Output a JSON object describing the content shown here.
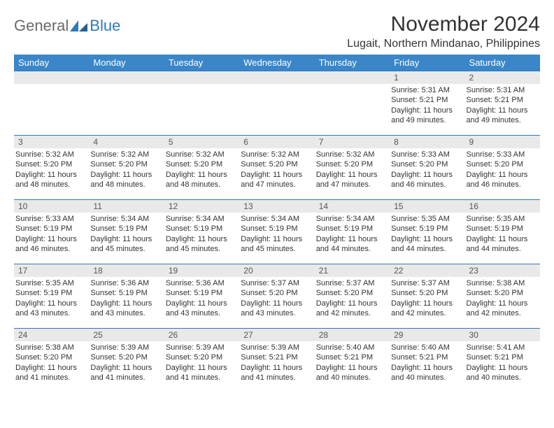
{
  "brand": {
    "general": "General",
    "blue": "Blue"
  },
  "title": "November 2024",
  "location": "Lugait, Northern Mindanao, Philippines",
  "weekdays": [
    "Sunday",
    "Monday",
    "Tuesday",
    "Wednesday",
    "Thursday",
    "Friday",
    "Saturday"
  ],
  "weeks": [
    [
      null,
      null,
      null,
      null,
      null,
      {
        "n": "1",
        "sr": "Sunrise: 5:31 AM",
        "ss": "Sunset: 5:21 PM",
        "dl": "Daylight: 11 hours and 49 minutes."
      },
      {
        "n": "2",
        "sr": "Sunrise: 5:31 AM",
        "ss": "Sunset: 5:21 PM",
        "dl": "Daylight: 11 hours and 49 minutes."
      }
    ],
    [
      {
        "n": "3",
        "sr": "Sunrise: 5:32 AM",
        "ss": "Sunset: 5:20 PM",
        "dl": "Daylight: 11 hours and 48 minutes."
      },
      {
        "n": "4",
        "sr": "Sunrise: 5:32 AM",
        "ss": "Sunset: 5:20 PM",
        "dl": "Daylight: 11 hours and 48 minutes."
      },
      {
        "n": "5",
        "sr": "Sunrise: 5:32 AM",
        "ss": "Sunset: 5:20 PM",
        "dl": "Daylight: 11 hours and 48 minutes."
      },
      {
        "n": "6",
        "sr": "Sunrise: 5:32 AM",
        "ss": "Sunset: 5:20 PM",
        "dl": "Daylight: 11 hours and 47 minutes."
      },
      {
        "n": "7",
        "sr": "Sunrise: 5:32 AM",
        "ss": "Sunset: 5:20 PM",
        "dl": "Daylight: 11 hours and 47 minutes."
      },
      {
        "n": "8",
        "sr": "Sunrise: 5:33 AM",
        "ss": "Sunset: 5:20 PM",
        "dl": "Daylight: 11 hours and 46 minutes."
      },
      {
        "n": "9",
        "sr": "Sunrise: 5:33 AM",
        "ss": "Sunset: 5:20 PM",
        "dl": "Daylight: 11 hours and 46 minutes."
      }
    ],
    [
      {
        "n": "10",
        "sr": "Sunrise: 5:33 AM",
        "ss": "Sunset: 5:19 PM",
        "dl": "Daylight: 11 hours and 46 minutes."
      },
      {
        "n": "11",
        "sr": "Sunrise: 5:34 AM",
        "ss": "Sunset: 5:19 PM",
        "dl": "Daylight: 11 hours and 45 minutes."
      },
      {
        "n": "12",
        "sr": "Sunrise: 5:34 AM",
        "ss": "Sunset: 5:19 PM",
        "dl": "Daylight: 11 hours and 45 minutes."
      },
      {
        "n": "13",
        "sr": "Sunrise: 5:34 AM",
        "ss": "Sunset: 5:19 PM",
        "dl": "Daylight: 11 hours and 45 minutes."
      },
      {
        "n": "14",
        "sr": "Sunrise: 5:34 AM",
        "ss": "Sunset: 5:19 PM",
        "dl": "Daylight: 11 hours and 44 minutes."
      },
      {
        "n": "15",
        "sr": "Sunrise: 5:35 AM",
        "ss": "Sunset: 5:19 PM",
        "dl": "Daylight: 11 hours and 44 minutes."
      },
      {
        "n": "16",
        "sr": "Sunrise: 5:35 AM",
        "ss": "Sunset: 5:19 PM",
        "dl": "Daylight: 11 hours and 44 minutes."
      }
    ],
    [
      {
        "n": "17",
        "sr": "Sunrise: 5:35 AM",
        "ss": "Sunset: 5:19 PM",
        "dl": "Daylight: 11 hours and 43 minutes."
      },
      {
        "n": "18",
        "sr": "Sunrise: 5:36 AM",
        "ss": "Sunset: 5:19 PM",
        "dl": "Daylight: 11 hours and 43 minutes."
      },
      {
        "n": "19",
        "sr": "Sunrise: 5:36 AM",
        "ss": "Sunset: 5:19 PM",
        "dl": "Daylight: 11 hours and 43 minutes."
      },
      {
        "n": "20",
        "sr": "Sunrise: 5:37 AM",
        "ss": "Sunset: 5:20 PM",
        "dl": "Daylight: 11 hours and 43 minutes."
      },
      {
        "n": "21",
        "sr": "Sunrise: 5:37 AM",
        "ss": "Sunset: 5:20 PM",
        "dl": "Daylight: 11 hours and 42 minutes."
      },
      {
        "n": "22",
        "sr": "Sunrise: 5:37 AM",
        "ss": "Sunset: 5:20 PM",
        "dl": "Daylight: 11 hours and 42 minutes."
      },
      {
        "n": "23",
        "sr": "Sunrise: 5:38 AM",
        "ss": "Sunset: 5:20 PM",
        "dl": "Daylight: 11 hours and 42 minutes."
      }
    ],
    [
      {
        "n": "24",
        "sr": "Sunrise: 5:38 AM",
        "ss": "Sunset: 5:20 PM",
        "dl": "Daylight: 11 hours and 41 minutes."
      },
      {
        "n": "25",
        "sr": "Sunrise: 5:39 AM",
        "ss": "Sunset: 5:20 PM",
        "dl": "Daylight: 11 hours and 41 minutes."
      },
      {
        "n": "26",
        "sr": "Sunrise: 5:39 AM",
        "ss": "Sunset: 5:20 PM",
        "dl": "Daylight: 11 hours and 41 minutes."
      },
      {
        "n": "27",
        "sr": "Sunrise: 5:39 AM",
        "ss": "Sunset: 5:21 PM",
        "dl": "Daylight: 11 hours and 41 minutes."
      },
      {
        "n": "28",
        "sr": "Sunrise: 5:40 AM",
        "ss": "Sunset: 5:21 PM",
        "dl": "Daylight: 11 hours and 40 minutes."
      },
      {
        "n": "29",
        "sr": "Sunrise: 5:40 AM",
        "ss": "Sunset: 5:21 PM",
        "dl": "Daylight: 11 hours and 40 minutes."
      },
      {
        "n": "30",
        "sr": "Sunrise: 5:41 AM",
        "ss": "Sunset: 5:21 PM",
        "dl": "Daylight: 11 hours and 40 minutes."
      }
    ]
  ]
}
